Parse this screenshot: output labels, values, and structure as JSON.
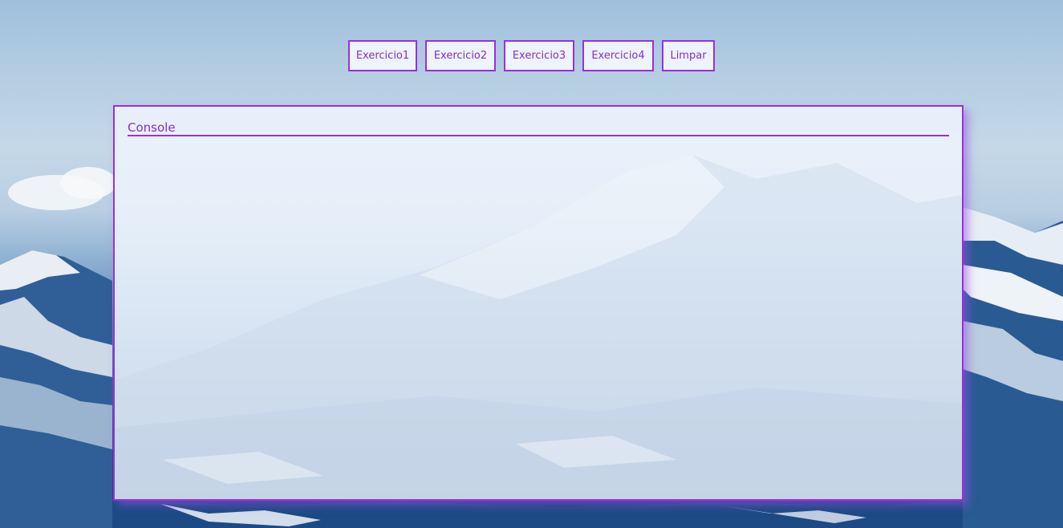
{
  "toolbar": {
    "buttons": [
      {
        "label": "Exercicio1"
      },
      {
        "label": "Exercicio2"
      },
      {
        "label": "Exercicio3"
      },
      {
        "label": "Exercicio4"
      },
      {
        "label": "Limpar"
      }
    ]
  },
  "console": {
    "title": "Console",
    "output": ""
  },
  "colors": {
    "accent": "#9b30d9",
    "button_text": "#8a2bd1",
    "panel_background": "#eef5fd"
  }
}
